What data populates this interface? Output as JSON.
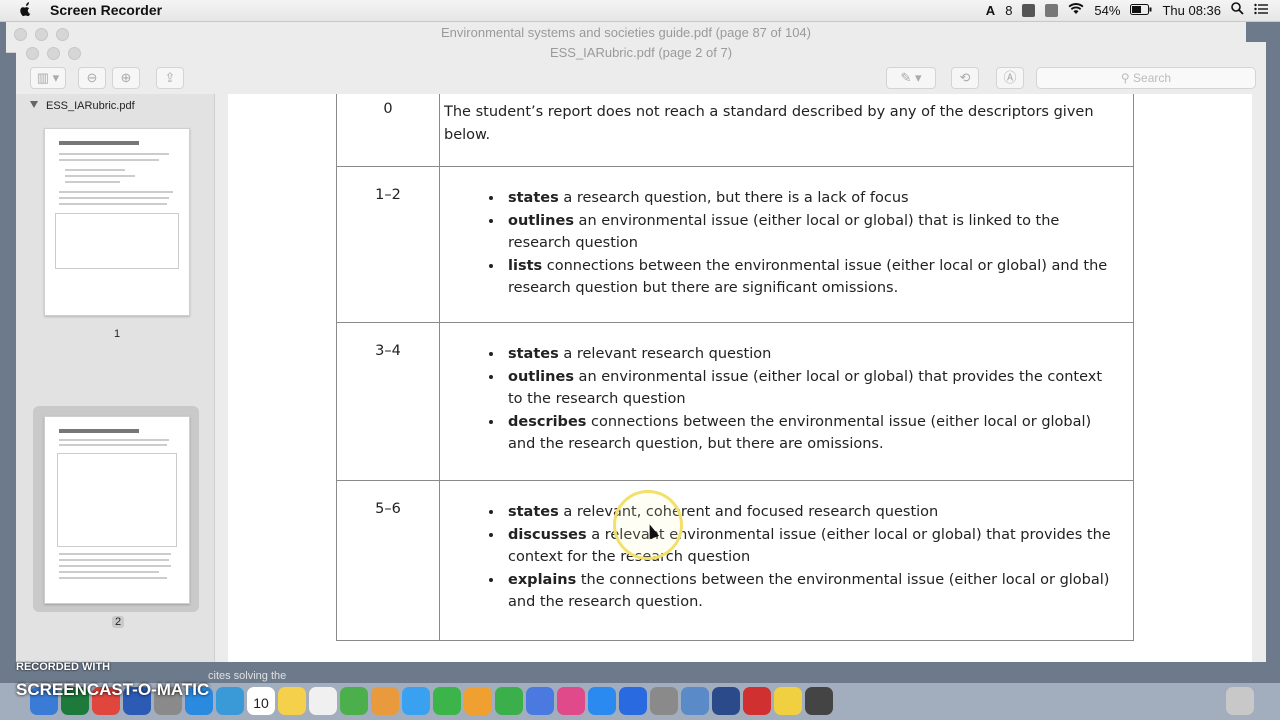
{
  "menubar": {
    "app_name": "Screen Recorder",
    "badge": "8",
    "battery": "54%",
    "clock": "Thu 08:36"
  },
  "back_window": {
    "title": "Environmental systems and societies guide.pdf (page 87 of 104)"
  },
  "window": {
    "title": "ESS_IARubric.pdf (page 2 of 7)"
  },
  "search": {
    "placeholder": "Search"
  },
  "sidebar": {
    "file_name": "ESS_IARubric.pdf",
    "pages": [
      "1",
      "2"
    ],
    "selected_page": "2"
  },
  "rubric": {
    "rows": [
      {
        "mark": "0",
        "text": "The student’s report does not reach a standard described by any of the descriptors given below.",
        "bullets": []
      },
      {
        "mark": "1–2",
        "text": "",
        "bullets": [
          {
            "bold": "states",
            "rest": " a research question, but there is a lack of focus"
          },
          {
            "bold": "outlines",
            "rest": " an environmental issue (either local or global) that is linked to the research question"
          },
          {
            "bold": "lists",
            "rest": " connections between the environmental issue (either local or global) and the research question but there are significant omissions."
          }
        ]
      },
      {
        "mark": "3–4",
        "text": "",
        "bullets": [
          {
            "bold": "states",
            "rest": " a relevant research question"
          },
          {
            "bold": "outlines",
            "rest": " an environmental issue (either local or global) that provides the context to the research question"
          },
          {
            "bold": "describes",
            "rest": " connections between the environmental issue (either local or global) and the research question, but there are omissions."
          }
        ]
      },
      {
        "mark": "5–6",
        "text": "",
        "bullets": [
          {
            "bold": "states",
            "rest": " a relevant, coherent and focused research question"
          },
          {
            "bold": "discusses",
            "rest": " a relevant environmental issue (either local or global) that provides the context for the research question"
          },
          {
            "bold": "explains",
            "rest": " the connections between the environmental issue (either local or global) and the research question."
          }
        ]
      }
    ]
  },
  "overlay": {
    "recorded_with": "RECORDED WITH",
    "logo": "SCREENCAST-O-MATIC",
    "caption": "cites solving the"
  },
  "dock": {
    "calendar_day": "10",
    "apps": [
      "finder-icon",
      "excel-icon",
      "chrome-icon",
      "word-icon",
      "launchpad-icon",
      "safari-icon",
      "preview-icon",
      "calendar-icon",
      "notes-icon",
      "reminders-icon",
      "maps-icon",
      "photos-icon",
      "messages-icon",
      "facetime-icon",
      "pages-icon",
      "numbers-icon",
      "keynote-icon",
      "itunes-icon",
      "appstore-icon",
      "zoom-icon",
      "system-preferences-icon",
      "preview2-icon",
      "quicktime-icon",
      "screenrec-icon",
      "stickies-icon",
      "screenshot-icon"
    ],
    "colors": [
      "#3a7bd5",
      "#1d7a3a",
      "#e0463c",
      "#2b5bb5",
      "#8a8a8a",
      "#2a8ae0",
      "#3a9ad8",
      "#ffffff",
      "#f5d04a",
      "#f0f0f0",
      "#4bb04b",
      "#e89a3c",
      "#3aa0f0",
      "#3bb54a",
      "#f0a030",
      "#3bb04a",
      "#4a7ae0",
      "#e04a8a",
      "#2a8af0",
      "#2a6ae0",
      "#8a8a8a",
      "#5a8ac8",
      "#2a4a8a",
      "#d03030",
      "#f0d040",
      "#444444"
    ]
  }
}
